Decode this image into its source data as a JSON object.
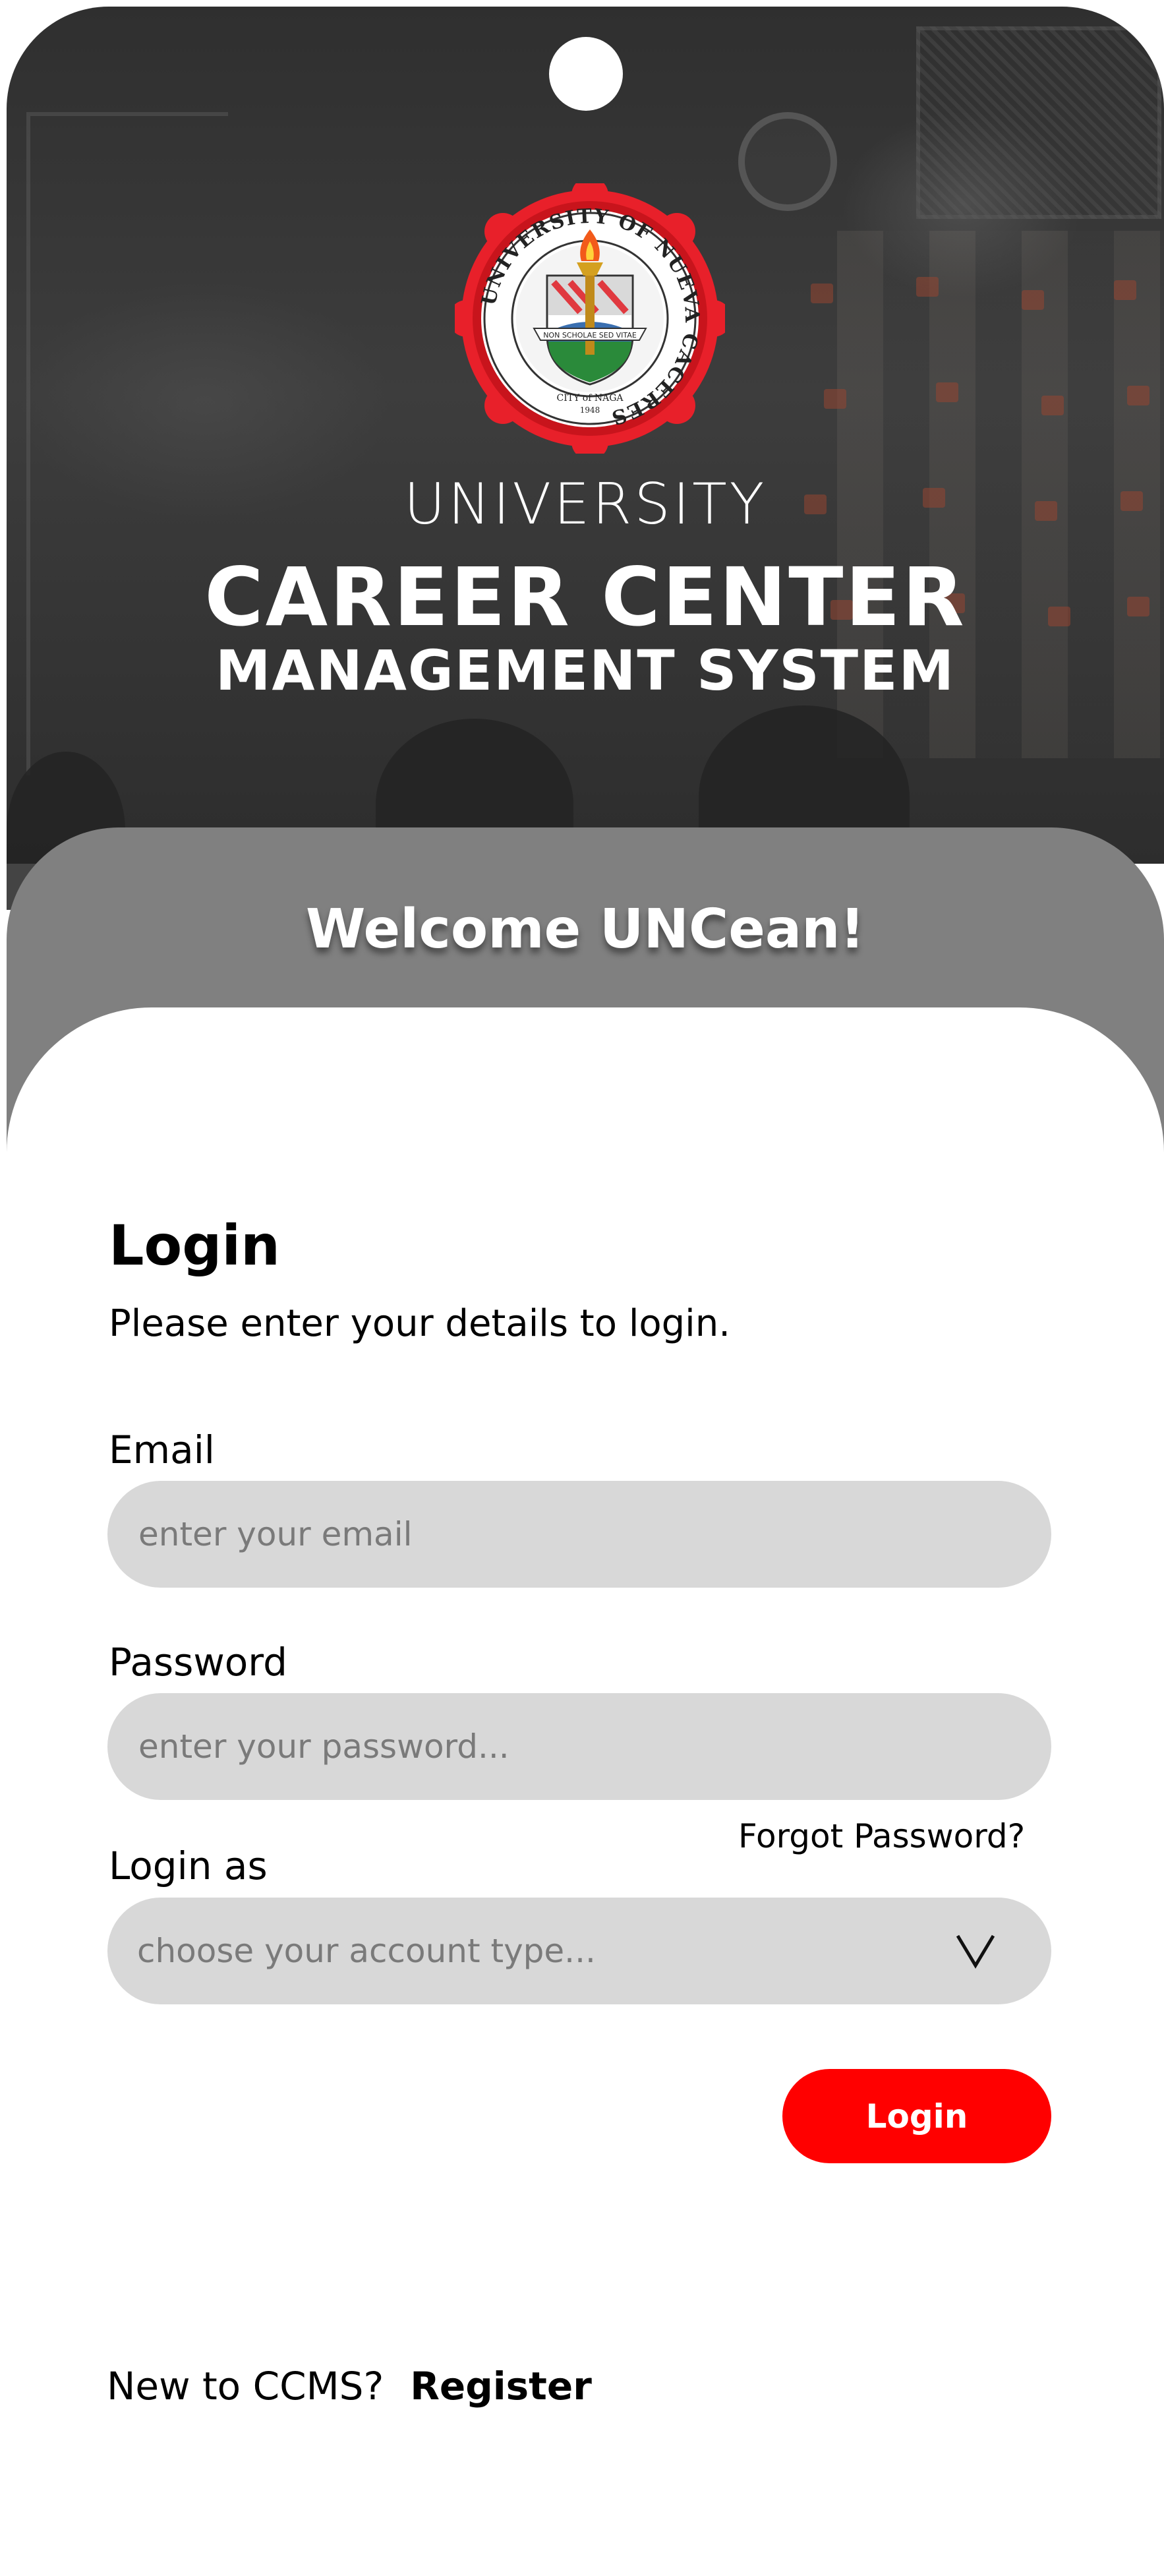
{
  "hero": {
    "title_line1": "UNIVERSITY",
    "title_line2": "CAREER CENTER",
    "title_line3": "MANAGEMENT SYSTEM",
    "seal_text_top": "UNIVERSITY OF NUEVA CACERES",
    "seal_motto": "NON SCHOLAE SED VITAE",
    "seal_city": "CITY of NAGA",
    "seal_year": "1948"
  },
  "welcome": {
    "text": "Welcome UNCean!"
  },
  "form": {
    "title": "Login",
    "subtitle": "Please enter your details to login.",
    "email_label": "Email",
    "email_placeholder": "enter your email",
    "password_label": "Password",
    "password_placeholder": "enter your password...",
    "forgot_label": "Forgot Password?",
    "login_as_label": "Login as",
    "account_type_placeholder": "choose your account type...",
    "login_button": "Login"
  },
  "footer": {
    "prompt": "New to CCMS?",
    "register_link": "Register"
  },
  "colors": {
    "accent": "#ff0000",
    "band": "#808080",
    "field_bg": "#d8d8d8"
  }
}
